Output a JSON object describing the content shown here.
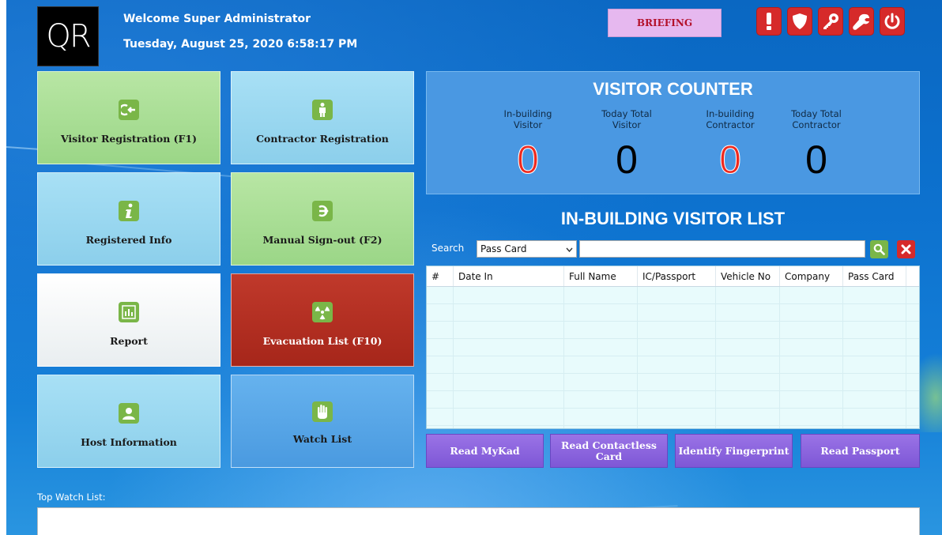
{
  "header": {
    "logo_text": "QR",
    "welcome": "Welcome Super Administrator",
    "datetime": "Tuesday, August 25, 2020 6:58:17 PM",
    "briefing_label": "BRIEFING",
    "top_icons": [
      "alert-icon",
      "shield-icon",
      "key-icon",
      "wrench-icon",
      "power-icon"
    ]
  },
  "tiles": [
    {
      "label": "Visitor Registration (F1)",
      "icon": "sign-in-icon"
    },
    {
      "label": "Contractor Registration",
      "icon": "person-icon"
    },
    {
      "label": "Registered Info",
      "icon": "info-icon"
    },
    {
      "label": "Manual Sign-out (F2)",
      "icon": "sign-out-icon"
    },
    {
      "label": "Report",
      "icon": "bar-chart-icon"
    },
    {
      "label": "Evacuation List (F10)",
      "icon": "radiation-icon"
    },
    {
      "label": "Host Information",
      "icon": "user-icon"
    },
    {
      "label": "Watch List",
      "icon": "hand-icon"
    }
  ],
  "counter": {
    "title": "VISITOR COUNTER",
    "items": [
      {
        "label_line1": "In-building",
        "label_line2": "Visitor",
        "value": "0"
      },
      {
        "label_line1": "Today Total",
        "label_line2": "Visitor",
        "value": "0"
      },
      {
        "label_line1": "In-building",
        "label_line2": "Contractor",
        "value": "0"
      },
      {
        "label_line1": "Today Total",
        "label_line2": "Contractor",
        "value": "0"
      }
    ]
  },
  "visitor_list": {
    "title": "IN-BUILDING VISITOR LIST",
    "search_label": "Search",
    "search_field": "Pass Card",
    "search_value": "",
    "columns": [
      "#",
      "Date In",
      "Full Name",
      "IC/Passport",
      "Vehicle No",
      "Company",
      "Pass Card"
    ],
    "rows": []
  },
  "actions": {
    "read_mykad": "Read MyKad",
    "read_contactless_line1": "Read Contactless",
    "read_contactless_line2": "Card",
    "identify_fingerprint": "Identify Fingerprint",
    "read_passport": "Read Passport"
  },
  "watch": {
    "label": "Top Watch List:"
  },
  "colors": {
    "accent_red": "#d62a2a",
    "accent_green": "#7ab648",
    "accent_purple": "#7e57d6",
    "panel_blue": "#4a98e2"
  }
}
